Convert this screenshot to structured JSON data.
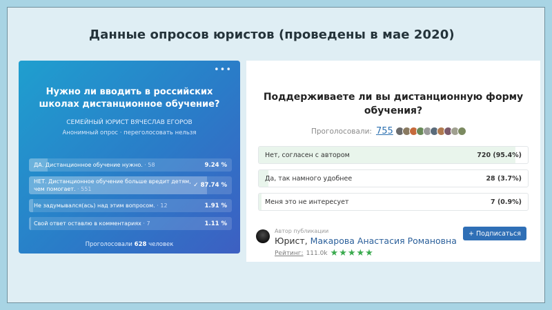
{
  "slide_title": "Данные опросов юристов (проведены в мае 2020)",
  "left_poll": {
    "menu": "•••",
    "question": "Нужно ли вводить в российских школах дистанционное обучение?",
    "author": "СЕМЕЙНЫЙ ЮРИСТ ВЯЧЕСЛАВ ЕГОРОВ",
    "poll_type": "Анонимный опрос · переголосовать нельзя",
    "options": [
      {
        "text": "ДА. Дистанционное обучение нужно.",
        "count": " · 58",
        "percent": "9.24 %",
        "fraction": 0.0924,
        "checked": false
      },
      {
        "text": "НЕТ. Дистанционное обучение больше вредит детям, чем помогает.",
        "count": " · 551",
        "percent": "87.74 %",
        "fraction": 0.8774,
        "checked": true
      },
      {
        "text": "Не задумывался(ась) над этим вопросом.",
        "count": " · 12",
        "percent": "1.91 %",
        "fraction": 0.0191,
        "checked": false
      },
      {
        "text": "Свой ответ оставлю в комментариях",
        "count": " · 7",
        "percent": "1.11 %",
        "fraction": 0.0111,
        "checked": false
      }
    ],
    "check_icon": "✓",
    "total_prefix": "Проголосовали ",
    "total_count": "628",
    "total_suffix": " человек"
  },
  "right_poll": {
    "question": "Поддерживаете ли вы дистанционную форму обучения?",
    "votes_label": "Проголосовали:",
    "votes_count": "755",
    "avatar_colors": [
      "#6b6b6b",
      "#8a7a60",
      "#c66a3b",
      "#6a8a5a",
      "#9a9a9a",
      "#5a6b7a",
      "#b07a50",
      "#7a5a6b",
      "#a0a090",
      "#7b8a60"
    ],
    "options": [
      {
        "text": "Нет, согласен с автором",
        "value": "720 (95.4%)",
        "fraction": 0.954
      },
      {
        "text": "Да, так намного удобнее",
        "value": "28 (3.7%)",
        "fraction": 0.037
      },
      {
        "text": "Меня это не интересует",
        "value": "7 (0.9%)",
        "fraction": 0.009
      }
    ],
    "author_label": "Автор публикации",
    "author_prefix": "Юрист, ",
    "author_name": "Макарова Анастасия Романовна",
    "rating_label": "Рейтинг:",
    "rating_value": "111.0k",
    "stars": "★★★★★",
    "subscribe_label": "+ Подписаться"
  }
}
